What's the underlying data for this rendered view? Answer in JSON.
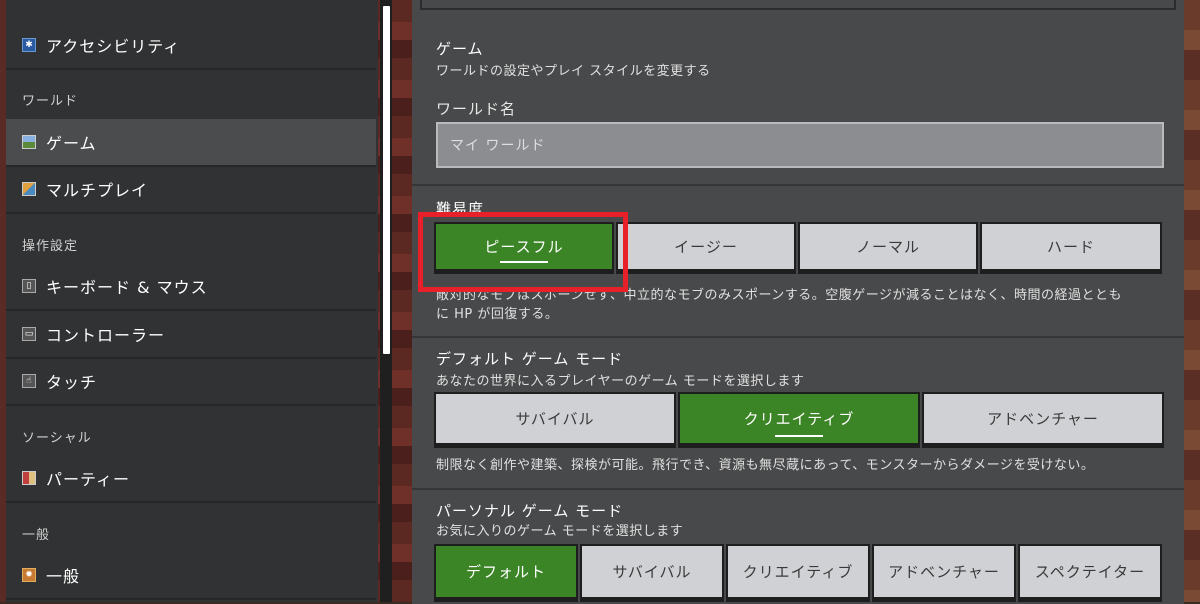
{
  "sidebar": {
    "items": [
      {
        "label": "アクセシビリティ",
        "icon": "accessibility-icon"
      },
      {
        "label": "ゲーム",
        "icon": "game-icon"
      },
      {
        "label": "マルチプレイ",
        "icon": "multiplayer-icon"
      },
      {
        "label": "キーボード & マウス",
        "icon": "keyboard-icon"
      },
      {
        "label": "コントローラー",
        "icon": "controller-icon"
      },
      {
        "label": "タッチ",
        "icon": "touch-icon"
      },
      {
        "label": "パーティー",
        "icon": "party-icon"
      },
      {
        "label": "一般",
        "icon": "general-icon"
      }
    ],
    "headers": [
      "ワールド",
      "操作設定",
      "ソーシャル",
      "一般"
    ]
  },
  "game_section": {
    "title": "ゲーム",
    "subtitle": "ワールドの設定やプレイ スタイルを変更する"
  },
  "world_name": {
    "label": "ワールド名",
    "placeholder": "マイ ワールド"
  },
  "difficulty": {
    "label": "難易度",
    "options": [
      "ピースフル",
      "イージー",
      "ノーマル",
      "ハード"
    ],
    "selected": "ピースフル",
    "description_line1": "敵対的なモブはスポーンせず、中立的なモブのみスポーンする。空腹ゲージが減ることはなく、時間の経過ととも",
    "description_line2": "に HP が回復する。"
  },
  "default_game_mode": {
    "title": "デフォルト ゲーム モード",
    "subtitle": "あなたの世界に入るプレイヤーのゲーム モードを選択します",
    "options": [
      "サバイバル",
      "クリエイティブ",
      "アドベンチャー"
    ],
    "selected": "クリエイティブ",
    "description": "制限なく創作や建築、探検が可能。飛行でき、資源も無尽蔵にあって、モンスターからダメージを受けない。"
  },
  "personal_game_mode": {
    "title": "パーソナル ゲーム モード",
    "subtitle": "お気に入りのゲーム モードを選択します",
    "options": [
      "デフォルト",
      "サバイバル",
      "クリエイティブ",
      "アドベンチャー",
      "スペクテイター"
    ],
    "selected": "デフォルト"
  },
  "colors": {
    "accent_green": "#3c8527",
    "highlight_red": "#e8202a",
    "button_gray": "#d0d1d4",
    "panel": "#48494a",
    "sidebar": "#313233"
  }
}
